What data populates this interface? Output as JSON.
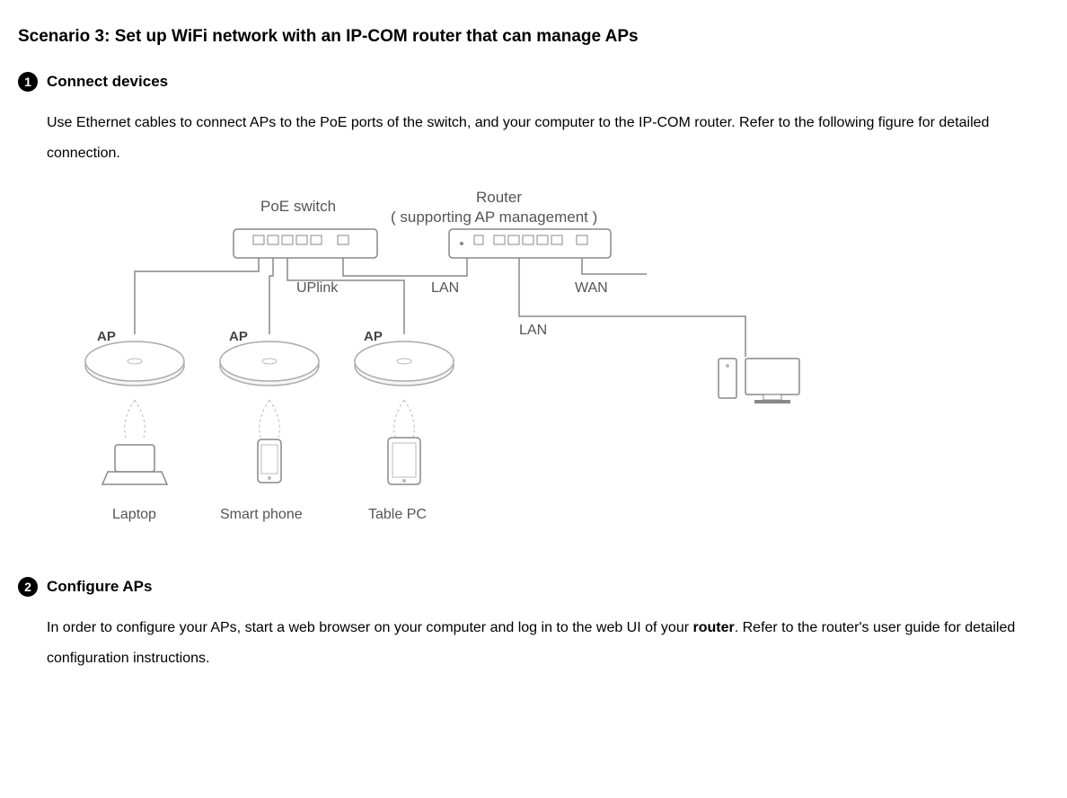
{
  "scenario": {
    "title": "Scenario 3: Set up WiFi network with an IP-COM router that can manage APs"
  },
  "step1": {
    "num": "1",
    "title": "Connect devices",
    "desc": "Use Ethernet cables to connect APs to the PoE ports of the switch, and your computer to the IP-COM router. Refer to the following figure for detailed connection."
  },
  "step2": {
    "num": "2",
    "title": "Configure APs",
    "desc_p1": "In order to configure your APs, start a web browser on your computer and log in to the web UI of your ",
    "desc_bold": "router",
    "desc_p2": ". Refer to the router's user guide for detailed configuration instructions."
  },
  "diagram": {
    "poe_switch_label": "PoE  switch",
    "router_label1": "Router",
    "router_label2": "( supporting  AP  management )",
    "uplink": "UPlink",
    "lan": "LAN",
    "wan": "WAN",
    "ap": "AP",
    "laptop": "Laptop",
    "smartphone": "Smart  phone",
    "tablet": "Table  PC"
  }
}
